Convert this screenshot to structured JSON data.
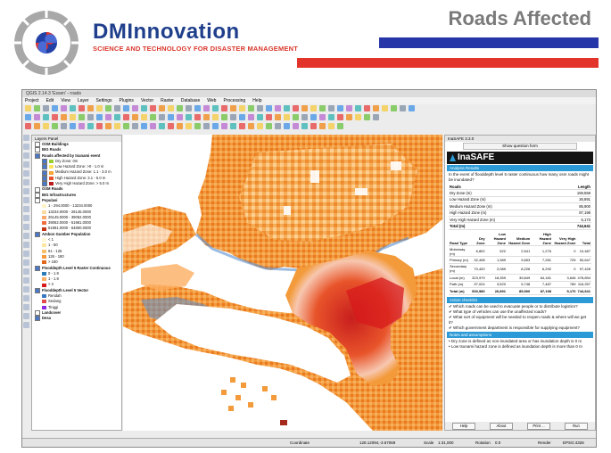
{
  "header": {
    "brand_title": "DMInnovation",
    "brand_subtitle": "SCIENCE AND TECHNOLOGY FOR DISASTER MANAGEMENT",
    "slide_title": "Roads Affected",
    "colors": {
      "brand_blue": "#1f3f8c",
      "brand_red": "#d9362b",
      "bar_blue": "#2636a8",
      "bar_red": "#e2342b"
    }
  },
  "window": {
    "title": "QGIS 2.14.3 'Essen' - roads",
    "menu": [
      "Project",
      "Edit",
      "View",
      "Layer",
      "Settings",
      "Plugins",
      "Vector",
      "Raster",
      "Database",
      "Web",
      "Processing",
      "Help"
    ]
  },
  "layers_panel": {
    "title": "Layers Panel",
    "items": [
      {
        "label": "OSM Buildings",
        "bold": true,
        "level": 0,
        "checked": false
      },
      {
        "label": "BIG Roads",
        "bold": true,
        "level": 0,
        "checked": false
      },
      {
        "label": "Roads affected by tsunami event",
        "bold": true,
        "level": 0,
        "checked": true
      },
      {
        "label": "Dry Zone: 0m",
        "bold": false,
        "level": 1,
        "checked": true,
        "swatch": "#9acd32"
      },
      {
        "label": "Low Hazard Zone: >0 - 1.0 m",
        "bold": false,
        "level": 1,
        "checked": true,
        "swatch": "#ffe25c"
      },
      {
        "label": "Medium Hazard Zone: 1.1 - 3.0 m",
        "bold": false,
        "level": 1,
        "checked": true,
        "swatch": "#f7a537"
      },
      {
        "label": "High Hazard Zone: 3.1 - 5.0 m",
        "bold": false,
        "level": 1,
        "checked": true,
        "swatch": "#e8542a"
      },
      {
        "label": "Very High Hazard Zone: > 5.0 m",
        "bold": false,
        "level": 1,
        "checked": true,
        "swatch": "#b91c1c"
      },
      {
        "label": "OSM Roads",
        "bold": true,
        "level": 0,
        "checked": false
      },
      {
        "label": "BIG Infrastructures",
        "bold": true,
        "level": 0,
        "checked": false
      },
      {
        "label": "Populasi",
        "bold": true,
        "level": 0,
        "checked": false
      },
      {
        "label": "1 - 294.0000 - 13234.0000",
        "bold": false,
        "level": 1,
        "checked": false,
        "swatch": "#fef3c7"
      },
      {
        "label": "13234.0000 - 26145.0000",
        "bold": false,
        "level": 1,
        "checked": false,
        "swatch": "#fcd9a0"
      },
      {
        "label": "26145.0000 - 39062.0000",
        "bold": false,
        "level": 1,
        "checked": false,
        "swatch": "#f9a96b"
      },
      {
        "label": "39062.0000 - 51981.0000",
        "bold": false,
        "level": 1,
        "checked": false,
        "swatch": "#ef6c3b"
      },
      {
        "label": "51981.0000 - 64800.0000",
        "bold": false,
        "level": 1,
        "checked": false,
        "swatch": "#c23616"
      },
      {
        "label": "Ambon Gumber Population",
        "bold": true,
        "level": 0,
        "checked": true
      },
      {
        "label": "< 1",
        "bold": false,
        "level": 1,
        "checked": false,
        "swatch": "#fff7d6"
      },
      {
        "label": "1 - 60",
        "bold": false,
        "level": 1,
        "checked": false,
        "swatch": "#fde6a0"
      },
      {
        "label": "61 - 125",
        "bold": false,
        "level": 1,
        "checked": false,
        "swatch": "#fbbf6a"
      },
      {
        "label": "126 - 180",
        "bold": false,
        "level": 1,
        "checked": false,
        "swatch": "#f59a3c"
      },
      {
        "label": "> 180",
        "bold": false,
        "level": 1,
        "checked": false,
        "swatch": "#e0661c"
      },
      {
        "label": "Flooddepth Level 5 Raster Continuous",
        "bold": true,
        "level": 0,
        "checked": true
      },
      {
        "label": "0 - 1.9",
        "bold": false,
        "level": 1,
        "checked": false,
        "swatch": "#2c7bb6"
      },
      {
        "label": "1 - 1.9",
        "bold": false,
        "level": 1,
        "checked": false,
        "swatch": "#fdae61"
      },
      {
        "label": "> 2",
        "bold": false,
        "level": 1,
        "checked": false,
        "swatch": "#d7191c"
      },
      {
        "label": "Flooddepth Level 5 Vector",
        "bold": true,
        "level": 0,
        "checked": true
      },
      {
        "label": "Rendah",
        "bold": false,
        "level": 1,
        "checked": false,
        "swatch": "#3a78c2"
      },
      {
        "label": "Sedang",
        "bold": false,
        "level": 1,
        "checked": false,
        "swatch": "#e04a4a"
      },
      {
        "label": "Tinggi",
        "bold": false,
        "level": 1,
        "checked": false,
        "swatch": "#8a2be2"
      },
      {
        "label": "Landcover",
        "bold": true,
        "level": 0,
        "checked": false
      },
      {
        "label": "Desa",
        "bold": true,
        "level": 0,
        "checked": true
      }
    ]
  },
  "inasafe": {
    "panel_title": "InaSAFE 3.3.0",
    "question_button": "Show question form",
    "logo_text": "InaSAFE",
    "analysis_header": "Analysis Results",
    "question": "In the event of flooddepth level 5 raster continuous how many osm roads might be inundated?",
    "summary": {
      "header": [
        "Roads",
        "Length"
      ],
      "rows": [
        [
          "Dry Zone (m)",
          "159,558"
        ],
        [
          "Low Hazard Zone (m)",
          "26,891"
        ],
        [
          "Medium Hazard Zone (m)",
          "85,900"
        ],
        [
          "High Hazard Zone (m)",
          "87,198"
        ],
        [
          "Very High Hazard Zone (m)",
          "5,173"
        ]
      ],
      "total": [
        "Total (m)",
        "744,641"
      ]
    },
    "matrix": {
      "header": [
        "Road Type",
        "Dry Zone",
        "Low Hazard Zone",
        "Medium Hazard Zone",
        "High Hazard Zone",
        "Very High Hazard Zone",
        "Total"
      ],
      "rows": [
        [
          "Motorway (m)",
          "6,802",
          "522",
          "2,541",
          "1,276",
          "0",
          "10,487"
        ],
        [
          "Primary (m)",
          "32,408",
          "1,389",
          "9,653",
          "7,281",
          "725",
          "50,647"
        ],
        [
          "Secondary (m)",
          "70,420",
          "2,089",
          "8,226",
          "6,292",
          "0",
          "97,428"
        ],
        [
          "Local (m)",
          "323,979",
          "18,359",
          "39,849",
          "64,181",
          "3,646",
          "478,894"
        ],
        [
          "Path (m)",
          "97,024",
          "3,520",
          "5,748",
          "7,487",
          "789",
          "116,257"
        ]
      ],
      "total": [
        "Total (m)",
        "530,580",
        "26,891",
        "85,900",
        "87,198",
        "5,170",
        "744,641"
      ]
    },
    "checklist_header": "Action checklist",
    "checklist": [
      "✔ Which roads can be used to evacuate people or to distribute logistics?",
      "✔ What type of vehicles can use the unaffected roads?",
      "✔ What sort of equipment will be needed to reopen roads & where will we get it?",
      "✔ Which government department is responsible for supplying equipment?"
    ],
    "notes_header": "Notes and assumptions",
    "notes": [
      "• Dry zone is defined as non-inundated area or has inundation depth is 0 m",
      "• Low tsunami hazard zone is defined as inundation depth is more than 0 m"
    ],
    "buttons": [
      "Help",
      "About",
      "Print ...",
      "Run"
    ]
  },
  "statusbar": {
    "coordinate_label": "Coordinate",
    "coordinate_value": "128.12094,-3.67069",
    "scale_label": "Scale",
    "scale_value": "1:31,000",
    "rotation_label": "Rotation",
    "rotation_value": "0.0",
    "render_label": "Render",
    "crs": "EPSG:4326"
  }
}
